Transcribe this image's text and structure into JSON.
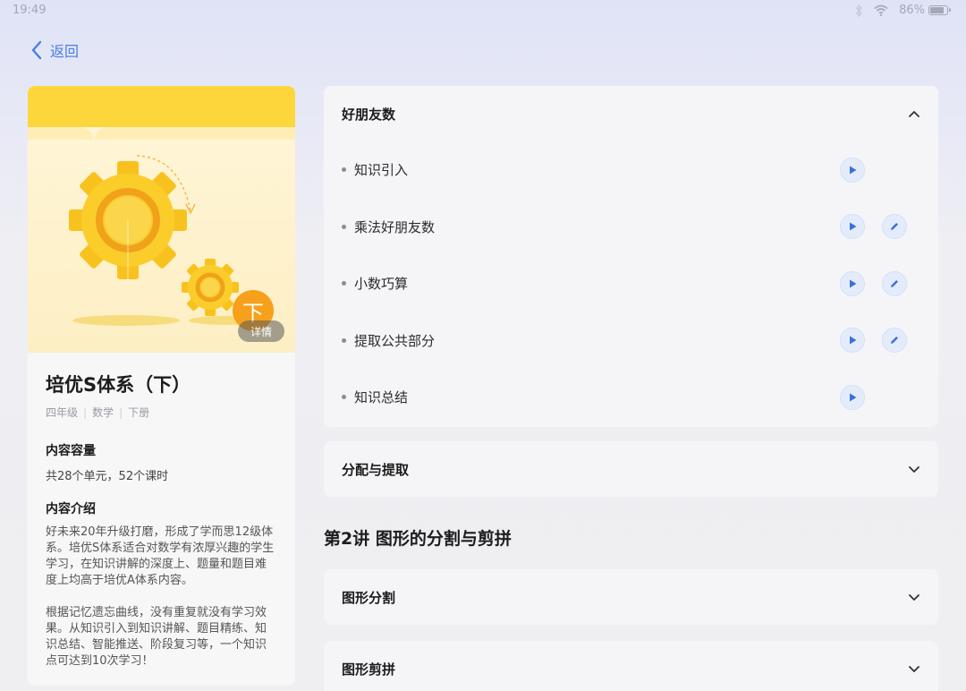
{
  "status_bar": {
    "time": "19:49",
    "battery": "86%",
    "battery_level": 0.86
  },
  "nav": {
    "back_label": "返回"
  },
  "course": {
    "cover_badge": "下",
    "detail_label": "详情",
    "title": "培优S体系（下）",
    "grade": "四年级",
    "subject": "数学",
    "volume": "下册",
    "capacity_heading": "内容容量",
    "capacity_text": "共28个单元，52个课时",
    "intro_heading": "内容介绍",
    "intro_text": "好未来20年升级打磨，形成了学而思12级体系。培优S体系适合对数学有浓厚兴趣的学生学习，在知识讲解的深度上、题量和题目难度上均高于培优A体系内容。\n\n根据记忆遗忘曲线，没有重复就没有学习效果。从知识引入到知识讲解、题目精练、知识总结、智能推送、阶段复习等，一个知识点可达到10次学习！\n\n趣味视频引入新知，激发兴趣；高频互动"
  },
  "units": [
    {
      "title": "好朋友数",
      "expanded": true,
      "lessons": [
        {
          "label": "知识引入",
          "play": true,
          "edit": false
        },
        {
          "label": "乘法好朋友数",
          "play": true,
          "edit": true
        },
        {
          "label": "小数巧算",
          "play": true,
          "edit": true
        },
        {
          "label": "提取公共部分",
          "play": true,
          "edit": true
        },
        {
          "label": "知识总结",
          "play": true,
          "edit": false
        }
      ]
    },
    {
      "title": "分配与提取",
      "expanded": false
    }
  ],
  "lecture2": {
    "title": "第2讲  图形的分割与剪拼",
    "units": [
      {
        "title": "图形分割",
        "expanded": false
      },
      {
        "title": "图形剪拼",
        "expanded": false
      }
    ]
  },
  "colors": {
    "accent": "#4a7be8",
    "cover_yellow": "#fdd63b",
    "badge_orange": "#f6a01b"
  }
}
